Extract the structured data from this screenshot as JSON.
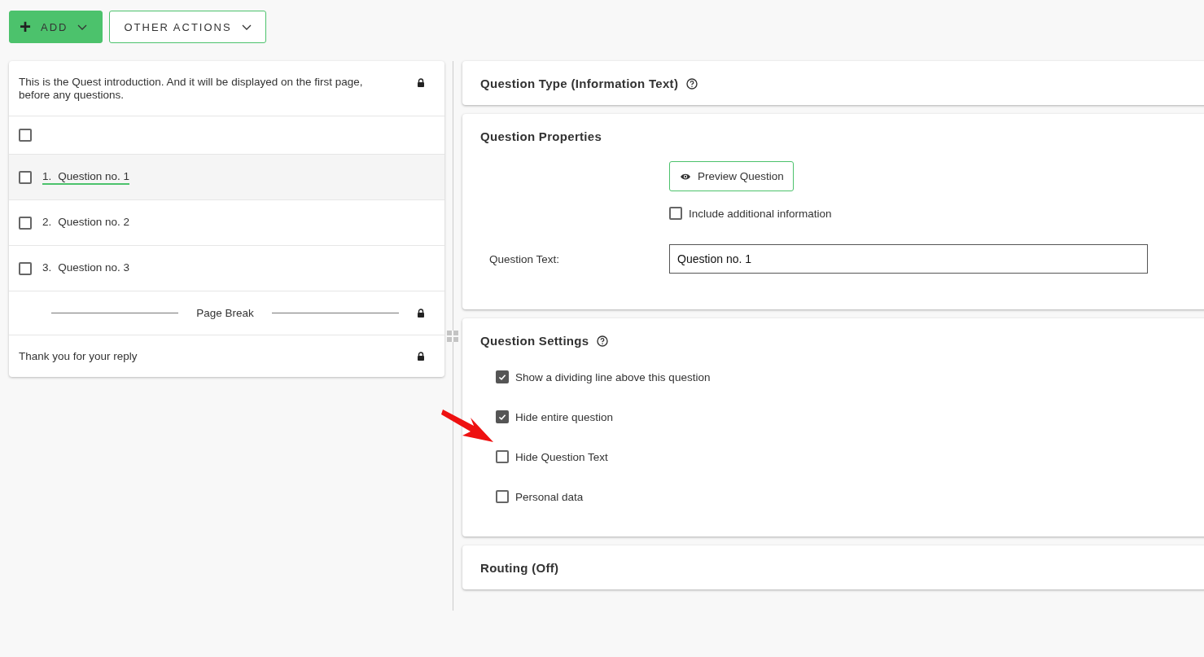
{
  "toolbar": {
    "add_button": {
      "icon": "+",
      "label": "ADD"
    },
    "other_actions_button": {
      "label": "OTHER ACTIONS"
    }
  },
  "question_list": [
    {
      "kind": "intro",
      "text": "This is the Quest introduction. And it will be displayed on the first page, before any questions.",
      "locked": true
    },
    {
      "kind": "select_all",
      "checked": false
    },
    {
      "kind": "question",
      "number": "1.",
      "label": "Question no. 1",
      "checked": false,
      "selected": true
    },
    {
      "kind": "question",
      "number": "2.",
      "label": "Question no. 2",
      "checked": false,
      "selected": false
    },
    {
      "kind": "question",
      "number": "3.",
      "label": "Question no. 3",
      "checked": false,
      "selected": false
    },
    {
      "kind": "page_break",
      "label": "Page Break",
      "locked": true
    },
    {
      "kind": "outro",
      "text": "Thank you for your reply",
      "locked": true
    }
  ],
  "question_type": {
    "title": "Question Type (Information Text)"
  },
  "question_properties": {
    "title": "Question Properties",
    "preview_button": "Preview Question",
    "include_additional_information": {
      "label": "Include additional information",
      "checked": false
    },
    "question_text": {
      "label": "Question Text:",
      "value": "Question no. 1"
    }
  },
  "question_settings": {
    "title": "Question Settings",
    "options": [
      {
        "label": "Show a dividing line above this question",
        "checked": true
      },
      {
        "label": "Hide entire question",
        "checked": true
      },
      {
        "label": "Hide Question Text",
        "checked": false
      },
      {
        "label": "Personal data",
        "checked": false
      }
    ]
  },
  "routing": {
    "title": "Routing (Off)"
  }
}
